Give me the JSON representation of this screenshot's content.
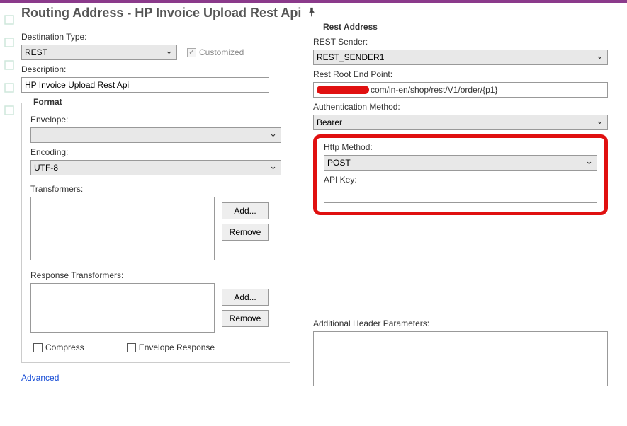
{
  "header": {
    "title": "Routing Address - HP Invoice Upload Rest Api"
  },
  "left": {
    "dest_type_label": "Destination Type:",
    "dest_type_value": "REST",
    "customized_label": "Customized",
    "description_label": "Description:",
    "description_value": "HP Invoice Upload Rest Api",
    "format_legend": "Format",
    "envelope_label": "Envelope:",
    "envelope_value": "",
    "encoding_label": "Encoding:",
    "encoding_value": "UTF-8",
    "transformers_label": "Transformers:",
    "response_transformers_label": "Response Transformers:",
    "add_btn": "Add...",
    "remove_btn": "Remove",
    "compress_label": "Compress",
    "envelope_response_label": "Envelope Response",
    "advanced_link": "Advanced"
  },
  "right": {
    "rest_address_legend": "Rest Address",
    "rest_sender_label": "REST Sender:",
    "rest_sender_value": "REST_SENDER1",
    "root_endpoint_label": "Rest Root End Point:",
    "root_endpoint_tail": "com/in-en/shop/rest/V1/order/{p1}",
    "auth_method_label": "Authentication Method:",
    "auth_method_value": "Bearer",
    "http_method_label": "Http Method:",
    "http_method_value": "POST",
    "api_key_label": "API Key:",
    "api_key_value": "",
    "additional_headers_label": "Additional Header Parameters:"
  }
}
